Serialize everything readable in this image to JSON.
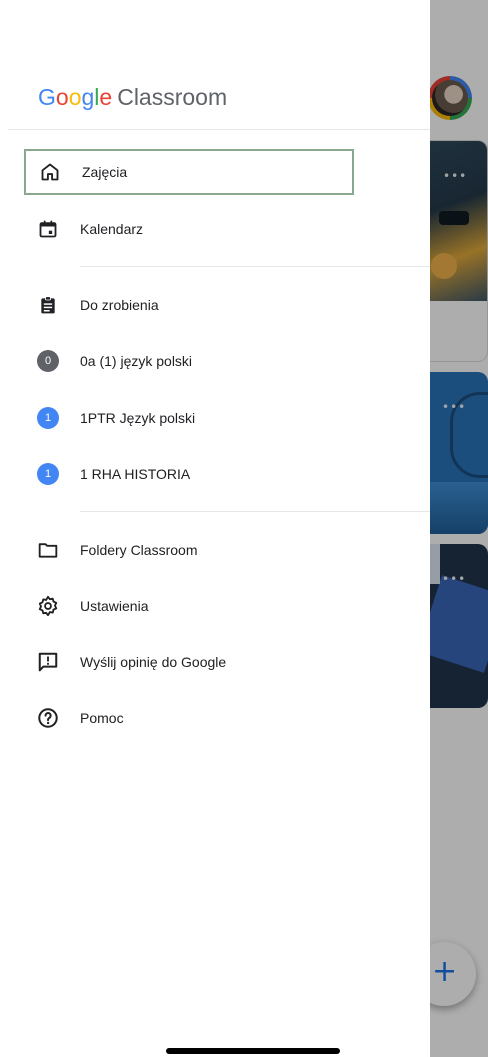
{
  "app": {
    "brand_g": [
      {
        "ch": "G",
        "color": "#4285F4"
      },
      {
        "ch": "o",
        "color": "#EA4335"
      },
      {
        "ch": "o",
        "color": "#FBBC05"
      },
      {
        "ch": "g",
        "color": "#4285F4"
      },
      {
        "ch": "l",
        "color": "#34A853"
      },
      {
        "ch": "e",
        "color": "#EA4335"
      }
    ],
    "brand_product": "Classroom"
  },
  "nav": {
    "primary": [
      {
        "label": "Zajęcia",
        "icon": "home-icon",
        "selected": true
      },
      {
        "label": "Kalendarz",
        "icon": "calendar-icon",
        "selected": false
      }
    ],
    "todo": {
      "label": "Do zrobienia",
      "icon": "assignment-icon"
    },
    "classes": [
      {
        "badge": "0",
        "badge_color": "#5f6368",
        "label": "0a (1) język polski"
      },
      {
        "badge": "1",
        "badge_color": "#4285F4",
        "label": "1PTR Język polski"
      },
      {
        "badge": "1",
        "badge_color": "#4285F4",
        "label": "1 RHA HISTORIA"
      }
    ],
    "secondary": [
      {
        "label": "Foldery Classroom",
        "icon": "folder-icon"
      },
      {
        "label": "Ustawienia",
        "icon": "settings-icon"
      },
      {
        "label": "Wyślij opinię do Google",
        "icon": "feedback-icon"
      },
      {
        "label": "Pomoc",
        "icon": "help-icon"
      }
    ]
  },
  "background": {
    "fab_symbol": "+",
    "menu_dots": "•••"
  },
  "colors": {
    "selection_border": "#8aa88e",
    "fab_plus": "#1a73e8"
  }
}
